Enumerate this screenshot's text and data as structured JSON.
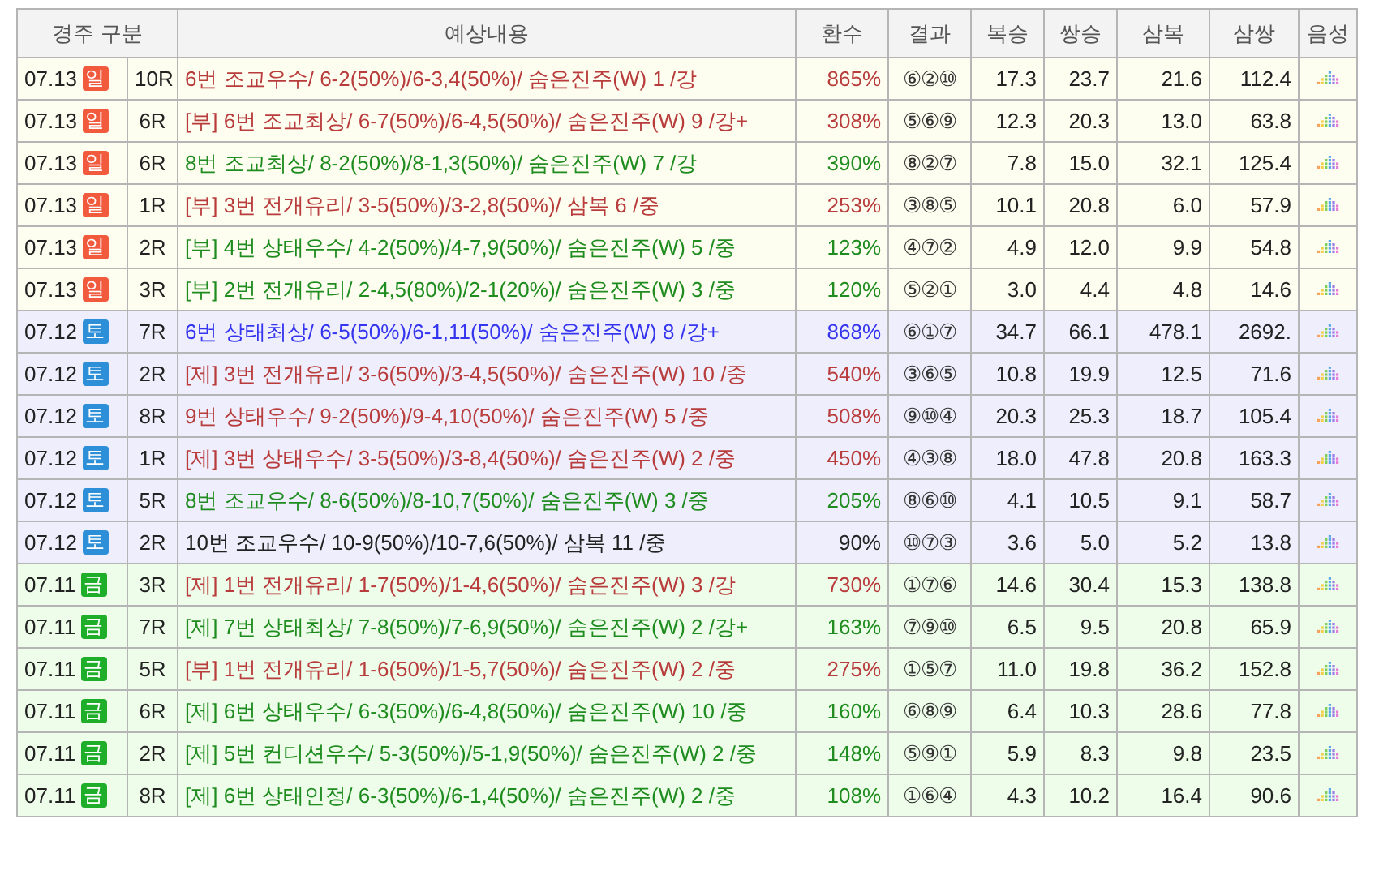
{
  "table": {
    "columns": [
      "경주 구분",
      "예상내용",
      "환수",
      "결과",
      "복승",
      "쌍승",
      "삼복",
      "삼쌍",
      "음성"
    ],
    "rows": [
      {
        "kind": "sunday",
        "date": "07.13",
        "day": {
          "label": "일",
          "color": "#f25a3e"
        },
        "race": "10R",
        "color": "#b83c3c",
        "content": "6번 조교우수/ 6-2(50%)/6-3,4(50%)/ 숨은진주(W) 1 /강",
        "return": "865%",
        "result": "⑥②⑩",
        "bokseung": "17.3",
        "ssangseung": "23.7",
        "sambok": "21.6",
        "samssang": "112.4"
      },
      {
        "kind": "sunday",
        "date": "07.13",
        "day": {
          "label": "일",
          "color": "#f25a3e"
        },
        "race": "6R",
        "color": "#b83c3c",
        "content": "[부] 6번 조교최상/ 6-7(50%)/6-4,5(50%)/ 숨은진주(W) 9 /강+",
        "return": "308%",
        "result": "⑤⑥⑨",
        "bokseung": "12.3",
        "ssangseung": "20.3",
        "sambok": "13.0",
        "samssang": "63.8"
      },
      {
        "kind": "sunday",
        "date": "07.13",
        "day": {
          "label": "일",
          "color": "#f25a3e"
        },
        "race": "6R",
        "color": "#1f8c1f",
        "content": "8번 조교최상/ 8-2(50%)/8-1,3(50%)/ 숨은진주(W) 7 /강",
        "return": "390%",
        "result": "⑧②⑦",
        "bokseung": "7.8",
        "ssangseung": "15.0",
        "sambok": "32.1",
        "samssang": "125.4"
      },
      {
        "kind": "sunday",
        "date": "07.13",
        "day": {
          "label": "일",
          "color": "#f25a3e"
        },
        "race": "1R",
        "color": "#b83c3c",
        "content": "[부] 3번 전개유리/ 3-5(50%)/3-2,8(50%)/ 삼복 6 /중",
        "return": "253%",
        "result": "③⑧⑤",
        "bokseung": "10.1",
        "ssangseung": "20.8",
        "sambok": "6.0",
        "samssang": "57.9"
      },
      {
        "kind": "sunday",
        "date": "07.13",
        "day": {
          "label": "일",
          "color": "#f25a3e"
        },
        "race": "2R",
        "color": "#1f8c1f",
        "content": "[부] 4번 상태우수/ 4-2(50%)/4-7,9(50%)/ 숨은진주(W) 5 /중",
        "return": "123%",
        "result": "④⑦②",
        "bokseung": "4.9",
        "ssangseung": "12.0",
        "sambok": "9.9",
        "samssang": "54.8"
      },
      {
        "kind": "sunday",
        "date": "07.13",
        "day": {
          "label": "일",
          "color": "#f25a3e"
        },
        "race": "3R",
        "color": "#1f8c1f",
        "content": "[부] 2번 전개유리/ 2-4,5(80%)/2-1(20%)/ 숨은진주(W) 3 /중",
        "return": "120%",
        "result": "⑤②①",
        "bokseung": "3.0",
        "ssangseung": "4.4",
        "sambok": "4.8",
        "samssang": "14.6"
      },
      {
        "kind": "saturday",
        "date": "07.12",
        "day": {
          "label": "토",
          "color": "#2e8fd9"
        },
        "race": "7R",
        "color": "#3535f0",
        "content": "6번 상태최상/ 6-5(50%)/6-1,11(50%)/ 숨은진주(W) 8 /강+",
        "return": "868%",
        "result": "⑥①⑦",
        "bokseung": "34.7",
        "ssangseung": "66.1",
        "sambok": "478.1",
        "samssang": "2692."
      },
      {
        "kind": "saturday",
        "date": "07.12",
        "day": {
          "label": "토",
          "color": "#2e8fd9"
        },
        "race": "2R",
        "color": "#b83c3c",
        "content": "[제] 3번 전개유리/ 3-6(50%)/3-4,5(50%)/ 숨은진주(W) 10 /중",
        "return": "540%",
        "result": "③⑥⑤",
        "bokseung": "10.8",
        "ssangseung": "19.9",
        "sambok": "12.5",
        "samssang": "71.6"
      },
      {
        "kind": "saturday",
        "date": "07.12",
        "day": {
          "label": "토",
          "color": "#2e8fd9"
        },
        "race": "8R",
        "color": "#b83c3c",
        "content": "9번 상태우수/ 9-2(50%)/9-4,10(50%)/ 숨은진주(W) 5 /중",
        "return": "508%",
        "result": "⑨⑩④",
        "bokseung": "20.3",
        "ssangseung": "25.3",
        "sambok": "18.7",
        "samssang": "105.4"
      },
      {
        "kind": "saturday",
        "date": "07.12",
        "day": {
          "label": "토",
          "color": "#2e8fd9"
        },
        "race": "1R",
        "color": "#b83c3c",
        "content": "[제] 3번 상태우수/ 3-5(50%)/3-8,4(50%)/ 숨은진주(W) 2 /중",
        "return": "450%",
        "result": "④③⑧",
        "bokseung": "18.0",
        "ssangseung": "47.8",
        "sambok": "20.8",
        "samssang": "163.3"
      },
      {
        "kind": "saturday",
        "date": "07.12",
        "day": {
          "label": "토",
          "color": "#2e8fd9"
        },
        "race": "5R",
        "color": "#1f8c1f",
        "content": "8번 조교우수/ 8-6(50%)/8-10,7(50%)/ 숨은진주(W) 3 /중",
        "return": "205%",
        "result": "⑧⑥⑩",
        "bokseung": "4.1",
        "ssangseung": "10.5",
        "sambok": "9.1",
        "samssang": "58.7"
      },
      {
        "kind": "saturday",
        "date": "07.12",
        "day": {
          "label": "토",
          "color": "#2e8fd9"
        },
        "race": "2R",
        "color": "#222222",
        "content": "10번 조교우수/ 10-9(50%)/10-7,6(50%)/ 삼복 11 /중",
        "return": "90%",
        "result": "⑩⑦③",
        "bokseung": "3.6",
        "ssangseung": "5.0",
        "sambok": "5.2",
        "samssang": "13.8"
      },
      {
        "kind": "friday",
        "date": "07.11",
        "day": {
          "label": "금",
          "color": "#1fae2a"
        },
        "race": "3R",
        "color": "#b83c3c",
        "content": "[제] 1번 전개유리/ 1-7(50%)/1-4,6(50%)/ 숨은진주(W) 3 /강",
        "return": "730%",
        "result": "①⑦⑥",
        "bokseung": "14.6",
        "ssangseung": "30.4",
        "sambok": "15.3",
        "samssang": "138.8"
      },
      {
        "kind": "friday",
        "date": "07.11",
        "day": {
          "label": "금",
          "color": "#1fae2a"
        },
        "race": "7R",
        "color": "#1f8c1f",
        "content": "[제] 7번 상태최상/ 7-8(50%)/7-6,9(50%)/ 숨은진주(W) 2 /강+",
        "return": "163%",
        "result": "⑦⑨⑩",
        "bokseung": "6.5",
        "ssangseung": "9.5",
        "sambok": "20.8",
        "samssang": "65.9"
      },
      {
        "kind": "friday",
        "date": "07.11",
        "day": {
          "label": "금",
          "color": "#1fae2a"
        },
        "race": "5R",
        "color": "#b83c3c",
        "content": "[부] 1번 전개유리/ 1-6(50%)/1-5,7(50%)/ 숨은진주(W) 2 /중",
        "return": "275%",
        "result": "①⑤⑦",
        "bokseung": "11.0",
        "ssangseung": "19.8",
        "sambok": "36.2",
        "samssang": "152.8"
      },
      {
        "kind": "friday",
        "date": "07.11",
        "day": {
          "label": "금",
          "color": "#1fae2a"
        },
        "race": "6R",
        "color": "#1f8c1f",
        "content": "[제] 6번 상태우수/ 6-3(50%)/6-4,8(50%)/ 숨은진주(W) 10 /중",
        "return": "160%",
        "result": "⑥⑧⑨",
        "bokseung": "6.4",
        "ssangseung": "10.3",
        "sambok": "28.6",
        "samssang": "77.8"
      },
      {
        "kind": "friday",
        "date": "07.11",
        "day": {
          "label": "금",
          "color": "#1fae2a"
        },
        "race": "2R",
        "color": "#1f8c1f",
        "content": "[제] 5번 컨디션우수/ 5-3(50%)/5-1,9(50%)/ 숨은진주(W) 2 /중",
        "return": "148%",
        "result": "⑤⑨①",
        "bokseung": "5.9",
        "ssangseung": "8.3",
        "sambok": "9.8",
        "samssang": "23.5"
      },
      {
        "kind": "friday",
        "date": "07.11",
        "day": {
          "label": "금",
          "color": "#1fae2a"
        },
        "race": "8R",
        "color": "#1f8c1f",
        "content": "[제] 6번 상태인정/ 6-3(50%)/6-1,4(50%)/ 숨은진주(W) 2 /중",
        "return": "108%",
        "result": "①⑥④",
        "bokseung": "4.3",
        "ssangseung": "10.2",
        "sambok": "16.4",
        "samssang": "90.6"
      }
    ]
  }
}
